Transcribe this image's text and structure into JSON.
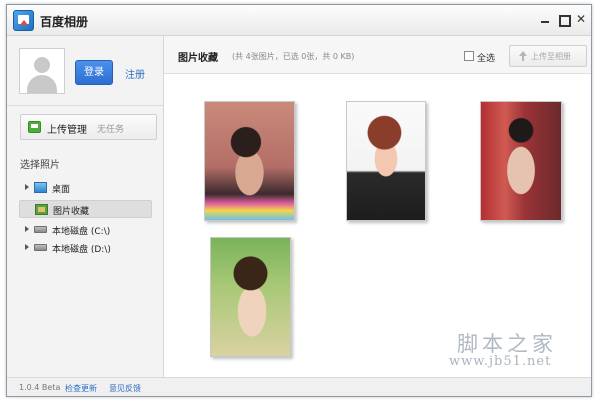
{
  "window": {
    "title": "百度相册"
  },
  "sidebar": {
    "login_label": "登录",
    "register_label": "注册",
    "upload_manager": {
      "label": "上传管理",
      "status": "无任务"
    },
    "section_title": "选择照片",
    "tree": [
      {
        "label": "桌面",
        "icon": "desktop-icon",
        "selected": false
      },
      {
        "label": "图片收藏",
        "icon": "photo-folder-icon",
        "selected": true
      },
      {
        "label": "本地磁盘 (C:\\)",
        "icon": "disk-icon",
        "selected": false
      },
      {
        "label": "本地磁盘 (D:\\)",
        "icon": "disk-icon",
        "selected": false
      }
    ]
  },
  "main": {
    "title": "图片收藏",
    "stats": "(共 4张图片，已选 0张，共 0 KB)",
    "select_all_label": "全选",
    "upload_button_label": "上传至相册",
    "photo_count": 4
  },
  "statusbar": {
    "version": "1.0.4 Beta",
    "check_update": "检查更新",
    "feedback": "意见反馈"
  },
  "watermark": {
    "text": "脚本之家",
    "url": "www.jb51.net"
  },
  "colors": {
    "accent_blue": "#2f6fc8",
    "login_button": "#3a7fdf"
  }
}
